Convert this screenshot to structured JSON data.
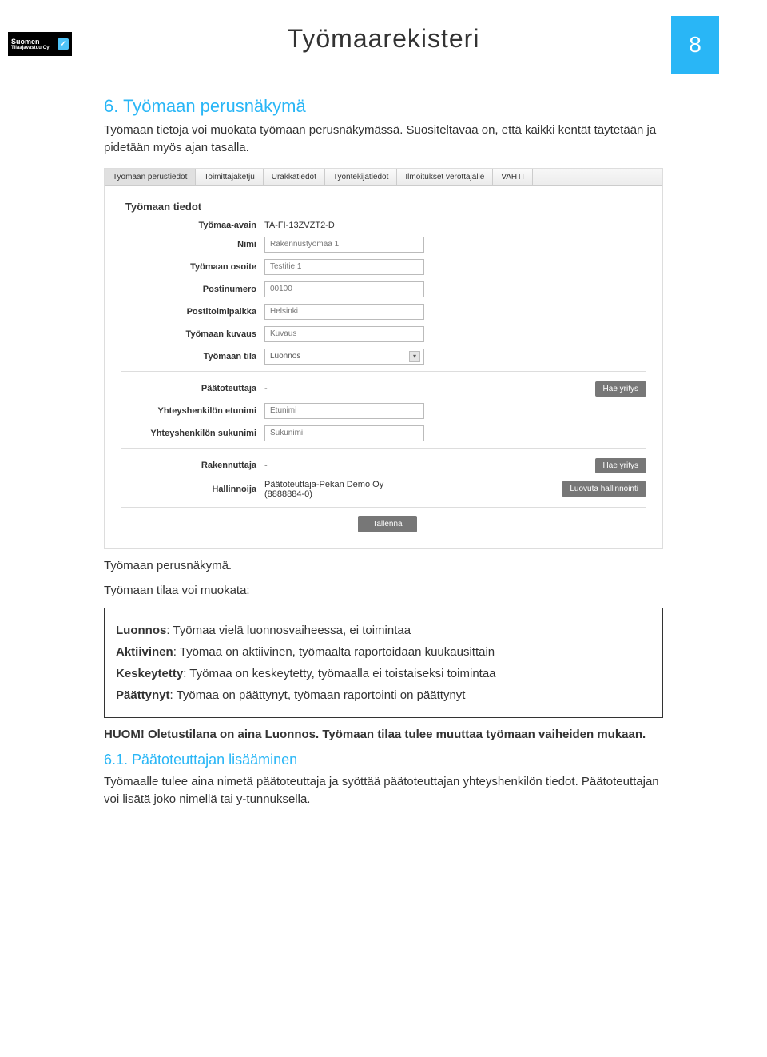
{
  "header": {
    "logo_line1": "Suomen",
    "logo_line2": "Tilaajavastuu Oy",
    "title": "Työmaarekisteri",
    "page_number": "8"
  },
  "section6": {
    "heading": "6.  Työmaan perusnäkymä",
    "intro": "Työmaan tietoja voi muokata työmaan perusnäkymässä. Suositeltavaa on, että kaikki kentät täytetään ja pidetään myös ajan tasalla."
  },
  "screenshot": {
    "tabs": [
      "Työmaan perustiedot",
      "Toimittajaketju",
      "Urakkatiedot",
      "Työntekijätiedot",
      "Ilmoitukset verottajalle",
      "VAHTI"
    ],
    "panel_title": "Työmaan tiedot",
    "fields": {
      "tyomaa_avain_label": "Työmaa-avain",
      "tyomaa_avain_value": "TA-FI-13ZVZT2-D",
      "nimi_label": "Nimi",
      "nimi_value": "Rakennustyömaa 1",
      "osoite_label": "Työmaan osoite",
      "osoite_value": "Testitie 1",
      "postinumero_label": "Postinumero",
      "postinumero_value": "00100",
      "postitoimipaikka_label": "Postitoimipaikka",
      "postitoimipaikka_value": "Helsinki",
      "kuvaus_label": "Työmaan kuvaus",
      "kuvaus_placeholder": "Kuvaus",
      "tila_label": "Työmaan tila",
      "tila_value": "Luonnos",
      "paatoteuttaja_label": "Päätoteuttaja",
      "paatoteuttaja_value": "-",
      "hae_yritys": "Hae yritys",
      "etunimi_label": "Yhteyshenkilön etunimi",
      "etunimi_placeholder": "Etunimi",
      "sukunimi_label": "Yhteyshenkilön sukunimi",
      "sukunimi_placeholder": "Sukunimi",
      "rakennuttaja_label": "Rakennuttaja",
      "rakennuttaja_value": "-",
      "hallinnoija_label": "Hallinnoija",
      "hallinnoija_value": "Päätoteuttaja-Pekan Demo Oy (8888884-0)",
      "luovuta": "Luovuta hallinnointi",
      "tallenna": "Tallenna"
    }
  },
  "caption": "Työmaan perusnäkymä.",
  "statuses": {
    "intro": "Työmaan tilaa voi muokata:",
    "items": [
      {
        "label": "Luonnos",
        "desc": ": Työmaa vielä luonnosvaiheessa, ei toimintaa"
      },
      {
        "label": "Aktiivinen",
        "desc": ": Työmaa on aktiivinen, työmaalta raportoidaan kuukausittain"
      },
      {
        "label": "Keskeytetty",
        "desc": ": Työmaa on keskeytetty, työmaalla ei toistaiseksi toimintaa"
      },
      {
        "label": "Päättynyt",
        "desc": ": Työmaa on päättynyt, työmaan raportointi on päättynyt"
      }
    ]
  },
  "note": "HUOM! Oletustilana on aina Luonnos. Työmaan tilaa tulee muuttaa työmaan vaiheiden mukaan.",
  "section61": {
    "heading": "6.1.   Päätoteuttajan lisääminen",
    "text": "Työmaalle tulee aina nimetä päätoteuttaja ja syöttää päätoteuttajan yhteyshenkilön tiedot. Päätoteuttajan voi lisätä joko nimellä tai y-tunnuksella."
  }
}
